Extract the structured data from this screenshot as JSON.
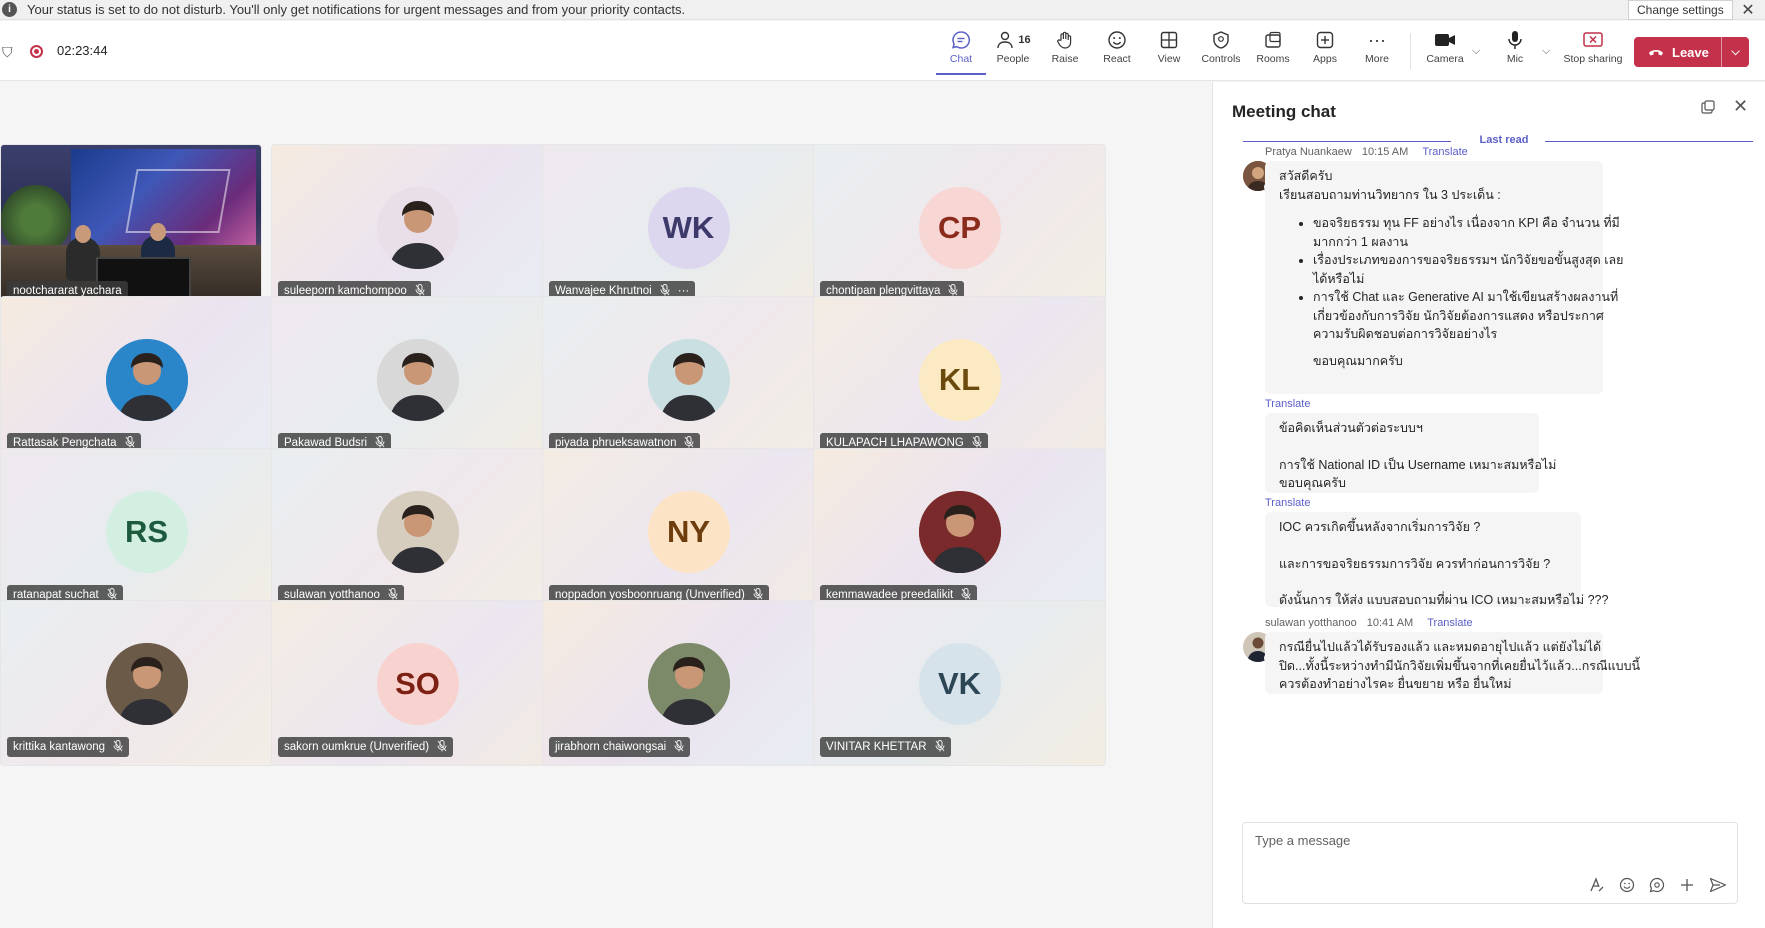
{
  "banner": {
    "message": "Your status is set to do not disturb. You'll only get notifications for urgent messages and from your priority contacts.",
    "change_settings": "Change settings",
    "close": "✕"
  },
  "toolbar": {
    "timer": "02:23:44",
    "people_count": "16",
    "buttons": [
      {
        "label": "Chat",
        "icon": "chat-icon"
      },
      {
        "label": "People",
        "icon": "people-icon"
      },
      {
        "label": "Raise",
        "icon": "raise-hand-icon"
      },
      {
        "label": "React",
        "icon": "react-icon"
      },
      {
        "label": "View",
        "icon": "view-icon"
      },
      {
        "label": "Controls",
        "icon": "controls-icon"
      },
      {
        "label": "Rooms",
        "icon": "rooms-icon"
      },
      {
        "label": "Apps",
        "icon": "apps-icon"
      },
      {
        "label": "More",
        "icon": "more-icon"
      },
      {
        "label": "Camera",
        "icon": "camera-icon"
      },
      {
        "label": "Mic",
        "icon": "mic-icon"
      },
      {
        "label": "Stop sharing",
        "icon": "stop-sharing-icon"
      }
    ],
    "leave_label": "Leave"
  },
  "participants": [
    {
      "name": "nootchararat yachara",
      "initials": "",
      "type": "video"
    },
    {
      "name": "suleeporn kamchompoo",
      "initials": "",
      "type": "photo",
      "color": "#e8dfe8"
    },
    {
      "name": "Wanvajee Khrutnoi",
      "initials": "WK",
      "type": "initials",
      "color": "#dcd6ef",
      "text_color": "#3d3a6b"
    },
    {
      "name": "chontipan plengvittaya",
      "initials": "CP",
      "type": "initials",
      "color": "#f7d6d3",
      "text_color": "#8a2b1c"
    },
    {
      "name": "Rattasak Pengchata",
      "initials": "",
      "type": "photo",
      "color": "#2a86c9"
    },
    {
      "name": "Pakawad Budsri",
      "initials": "",
      "type": "photo",
      "color": "#d8d8d8"
    },
    {
      "name": "piyada phrueksawatnon",
      "initials": "",
      "type": "photo",
      "color": "#c9dfe2"
    },
    {
      "name": "KULAPACH LHAPAWONG",
      "initials": "KL",
      "type": "initials",
      "color": "#fbeac3",
      "text_color": "#6b4a0d"
    },
    {
      "name": "ratanapat suchat",
      "initials": "RS",
      "type": "initials",
      "color": "#d3efe2",
      "text_color": "#1d5b3e"
    },
    {
      "name": "sulawan yotthanoo",
      "initials": "",
      "type": "photo",
      "color": "#d7cdbf"
    },
    {
      "name": "noppadon yosboonruang (Unverified)",
      "initials": "NY",
      "type": "initials",
      "color": "#fce3c5",
      "text_color": "#6e3d0d"
    },
    {
      "name": "kemmawadee preedalikit",
      "initials": "",
      "type": "photo",
      "color": "#7a2a2a"
    },
    {
      "name": "krittika kantawong",
      "initials": "",
      "type": "photo",
      "color": "#6b5a48"
    },
    {
      "name": "sakorn oumkrue (Unverified)",
      "initials": "SO",
      "type": "initials",
      "color": "#f8d2ce",
      "text_color": "#7c2013"
    },
    {
      "name": "jirabhorn chaiwongsai",
      "initials": "",
      "type": "photo",
      "color": "#7d8a6a"
    },
    {
      "name": "VINITAR KHETTAR",
      "initials": "VK",
      "type": "initials",
      "color": "#d7e3ea",
      "text_color": "#2c4656"
    }
  ],
  "chat": {
    "title": "Meeting chat",
    "last_read": "Last read",
    "translate": "Translate",
    "messages": [
      {
        "sender": "Pratya Nuankaew",
        "time": "10:15 AM",
        "intro": [
          "สวัสดีครับ",
          "เรียนสอบถามท่านวิทยากร ใน 3 ประเด็น :"
        ],
        "bullets": [
          [
            "ขอจริยธรรม ทุน FF อย่างไร เนื่องจาก KPI คือ จำนวน ที่มี",
            "มากกว่า 1 ผลงาน"
          ],
          [
            "เรื่องประเภทของการขอจริยธรรมฯ นักวิจัยขอขั้นสูงสุด เลย",
            "ได้หรือไม่"
          ],
          [
            "การใช้ Chat และ Generative AI มาใช้เขียนสร้างผลงานที่",
            "เกี่ยวข้องกับการวิจัย นักวิจัยต้องการแสดง หรือประกาศ",
            "ความรับผิดชอบต่อการวิจัยอย่างไร"
          ]
        ],
        "closing": "ขอบคุณมากครับ"
      },
      {
        "lines": [
          "ข้อคิดเห็นส่วนตัวต่อระบบฯ",
          "",
          "การใช้ National ID เป็น Username เหมาะสมหรือไม่",
          "ขอบคุณครับ"
        ]
      },
      {
        "lines": [
          "IOC ควรเกิดขึ้นหลังจากเริ่มการวิจัย ?",
          "",
          "และการขอจริยธรรมการวิจัย ควรทำก่อนการวิจัย ?",
          "",
          "ดังนั้นการ ให้ส่ง แบบสอบถามที่ผ่าน ICO เหมาะสมหรือไม่ ???"
        ]
      },
      {
        "sender": "sulawan yotthanoo",
        "time": "10:41 AM",
        "lines": [
          "กรณียื่นไปแล้วได้รับรองแล้ว และหมดอายุไปแล้ว แต่ยังไม่ได้",
          "ปิด...ทั้งนี้ระหว่างทำมีนักวิจัยเพิ่มขึ้นจากที่เคยยื่นไว้แล้ว...กรณีแบบนี้",
          "ควรต้องทำอย่างไรคะ ยื่นขยาย หรือ ยื่นใหม่"
        ]
      }
    ],
    "compose_placeholder": "Type a message"
  }
}
